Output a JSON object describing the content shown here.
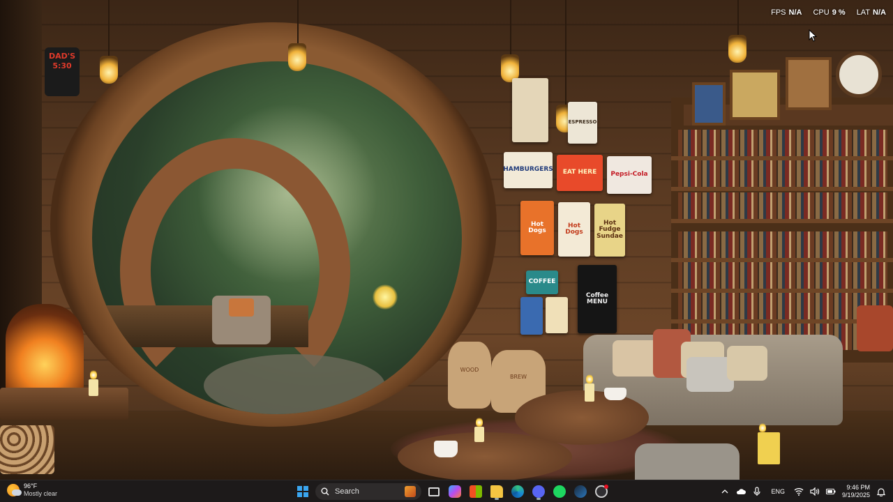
{
  "overlay": {
    "fps_label": "FPS",
    "fps_value": "N/A",
    "cpu_label": "CPU",
    "cpu_value": "9 %",
    "lat_label": "LAT",
    "lat_value": "N/A"
  },
  "wallpaper": {
    "sign_text": "DAD'S\n5:30",
    "posters": {
      "hamburgers": "HAMBURGERS",
      "eat_here": "EAT HERE",
      "pepsi": "Pepsi-Cola",
      "hotdogs1": "Hot Dogs",
      "hotdogs2": "Hot Dogs",
      "fudge": "Hot Fudge Sundae",
      "coffee": "COFFEE",
      "menu": "Coffee MENU",
      "espresso": "ESPRESSO"
    },
    "sacks": {
      "left": "WOOD",
      "right": "BREW"
    }
  },
  "taskbar": {
    "weather": {
      "temp": "96°F",
      "desc": "Mostly clear",
      "icon": "partly-cloudy-icon"
    },
    "search_label": "Search",
    "apps": [
      "task-view-icon",
      "copilot-icon",
      "microsoft-store-icon",
      "file-explorer-icon",
      "edge-icon",
      "discord-icon",
      "spotify-icon",
      "steam-icon",
      "obs-icon"
    ],
    "tray": {
      "language": "ENG",
      "time": "9:46 PM",
      "date": "9/19/2025"
    }
  },
  "colors": {
    "taskbar_bg": "#1d1a1a",
    "accent": "#3aa6f0"
  }
}
